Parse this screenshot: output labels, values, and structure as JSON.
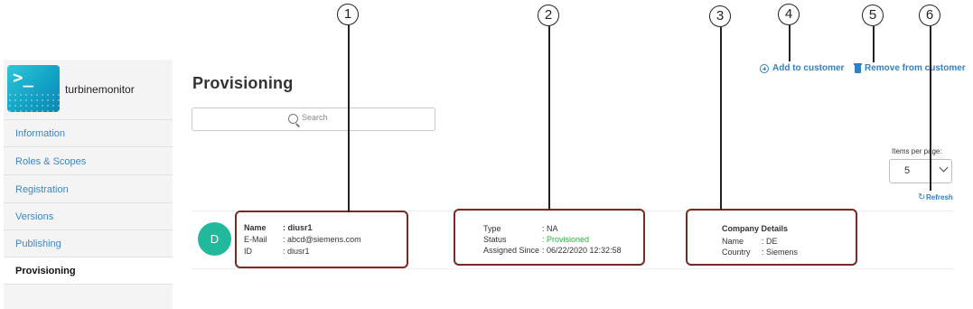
{
  "app": {
    "name": "turbinemonitor",
    "logo_icon": "terminal-prompt-icon",
    "logo_glyph": ">_"
  },
  "sidebar": {
    "items": [
      {
        "label": "Information",
        "active": false
      },
      {
        "label": "Roles & Scopes",
        "active": false
      },
      {
        "label": "Registration",
        "active": false
      },
      {
        "label": "Versions",
        "active": false
      },
      {
        "label": "Publishing",
        "active": false
      },
      {
        "label": "Provisioning",
        "active": true
      }
    ]
  },
  "page": {
    "title": "Provisioning"
  },
  "search": {
    "placeholder": "Search",
    "icon": "search-icon"
  },
  "actions": {
    "add_label": "Add to customer",
    "add_icon": "plus-circle-icon",
    "remove_label": "Remove from customer",
    "remove_icon": "trash-icon"
  },
  "pagination": {
    "label": "Items per page:",
    "value": "5",
    "icon": "chevron-down-icon"
  },
  "refresh": {
    "label": "Refresh",
    "icon": "refresh-icon"
  },
  "user_row": {
    "avatar_initial": "D",
    "user": {
      "name_label": "Name",
      "name_value": ": diusr1",
      "email_label": "E-Mail",
      "email_value": ": abcd@siemens.com",
      "id_label": "ID",
      "id_value": ": diusr1"
    },
    "status": {
      "type_label": "Type",
      "type_value": ": NA",
      "status_label": "Status",
      "status_value": ": Provisioned",
      "since_label": "Assigned Since",
      "since_value": ": 06/22/2020 12:32:58"
    },
    "company": {
      "title": "Company Details",
      "name_label": "Name",
      "name_value": ": DE",
      "country_label": "Country",
      "country_value": ": Siemens"
    }
  },
  "callouts": [
    "1",
    "2",
    "3",
    "4",
    "5",
    "6"
  ],
  "colors": {
    "accent": "#2f80c6",
    "avatar": "#21b89b",
    "provisioned": "#27b03e",
    "callout_border": "#7a2a22"
  }
}
